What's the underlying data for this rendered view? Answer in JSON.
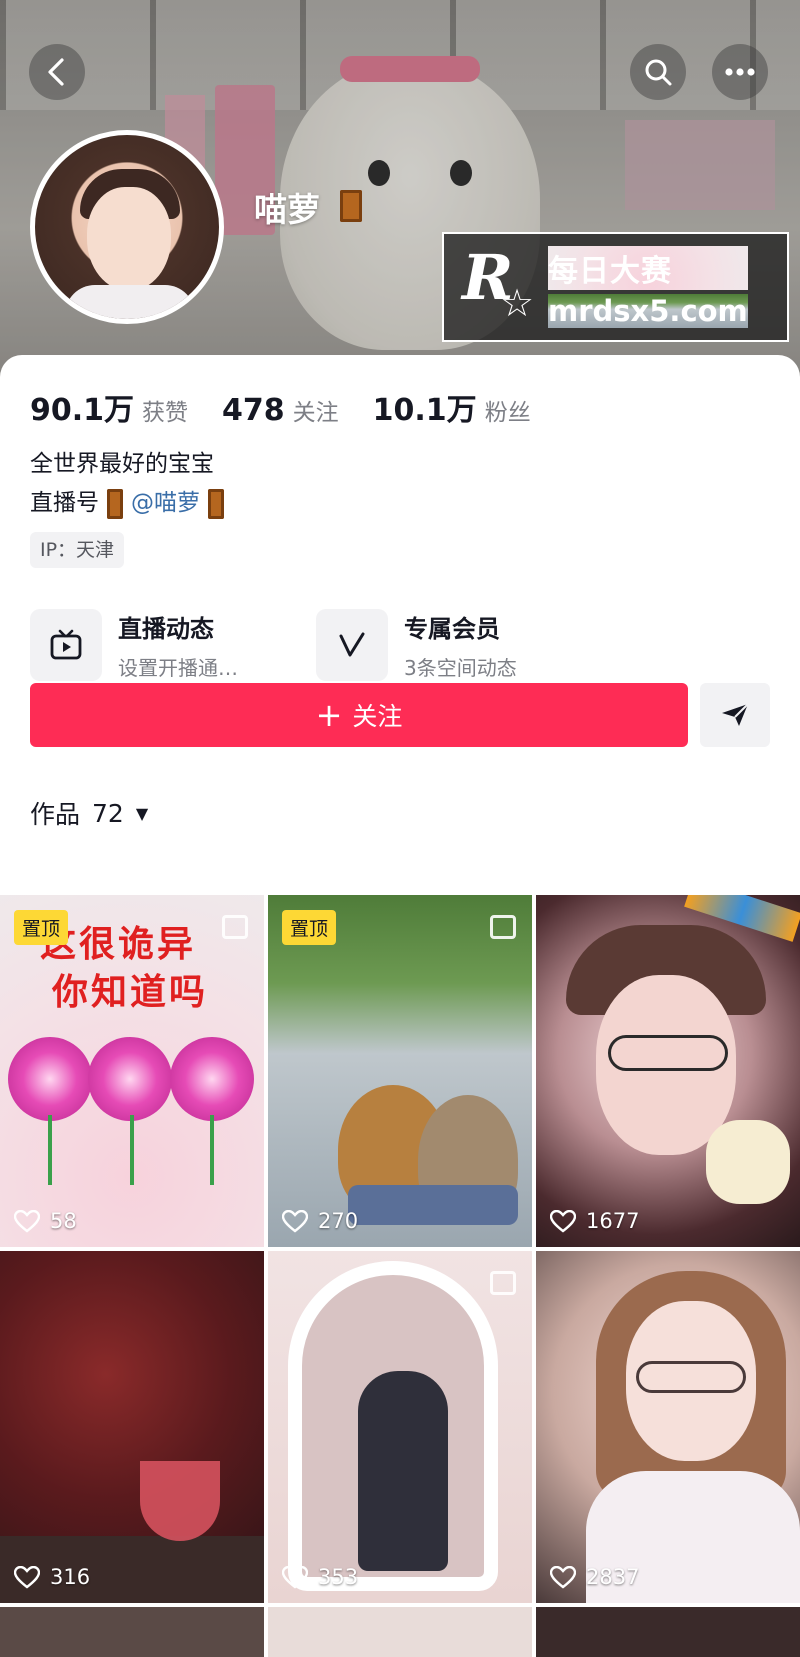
{
  "header": {
    "nickname": "喵萝",
    "watermark": {
      "logo_letter": "R",
      "title": "每日大赛",
      "url": "mrdsx5.com"
    }
  },
  "stats": [
    {
      "value": "90.1万",
      "label": "获赞"
    },
    {
      "value": "478",
      "label": "关注"
    },
    {
      "value": "10.1万",
      "label": "粉丝"
    }
  ],
  "bio": {
    "line1": "全世界最好的宝宝",
    "line2_prefix": "直播号",
    "mention": "@喵萝"
  },
  "ip_location": "IP：天津",
  "features": [
    {
      "title": "直播动态",
      "subtitle": "设置开播通…",
      "icon": "tv-icon"
    },
    {
      "title": "专属会员",
      "subtitle": "3条空间动态",
      "icon": "v-icon"
    }
  ],
  "actions": {
    "follow_label": "关注",
    "follow_plus": "+"
  },
  "works": {
    "label": "作品",
    "count": "72"
  },
  "videos": [
    {
      "likes": "58",
      "pinned": true,
      "pin_label": "置顶",
      "overlay_line1": "这很诡异",
      "overlay_line2": "你知道吗"
    },
    {
      "likes": "270",
      "pinned": true,
      "pin_label": "置顶"
    },
    {
      "likes": "1677",
      "pinned": false
    },
    {
      "likes": "316",
      "pinned": false
    },
    {
      "likes": "353",
      "pinned": false
    },
    {
      "likes": "2837",
      "pinned": false
    }
  ],
  "colors": {
    "accent": "#fe2c55",
    "pin_badge": "#fdd835",
    "mention": "#3a6ea8"
  }
}
